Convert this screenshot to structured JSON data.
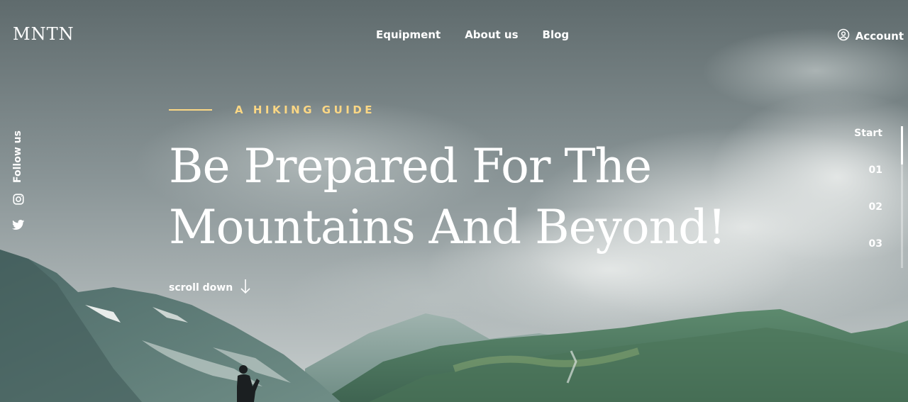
{
  "header": {
    "logo": "MNTN",
    "nav": [
      {
        "label": "Equipment"
      },
      {
        "label": "About us"
      },
      {
        "label": "Blog"
      }
    ],
    "account_label": "Account"
  },
  "social": {
    "follow_label": "Follow us",
    "icons": [
      "instagram-icon",
      "twitter-icon"
    ]
  },
  "hero": {
    "eyebrow": "A HIKING GUIDE",
    "headline_line1": "Be Prepared For The",
    "headline_line2": "Mountains And Beyond!",
    "scroll_label": "scroll down"
  },
  "slides": {
    "items": [
      "Start",
      "01",
      "02",
      "03"
    ],
    "progress": 0.27
  },
  "colors": {
    "accent": "#fbd784",
    "text": "#ffffff"
  }
}
